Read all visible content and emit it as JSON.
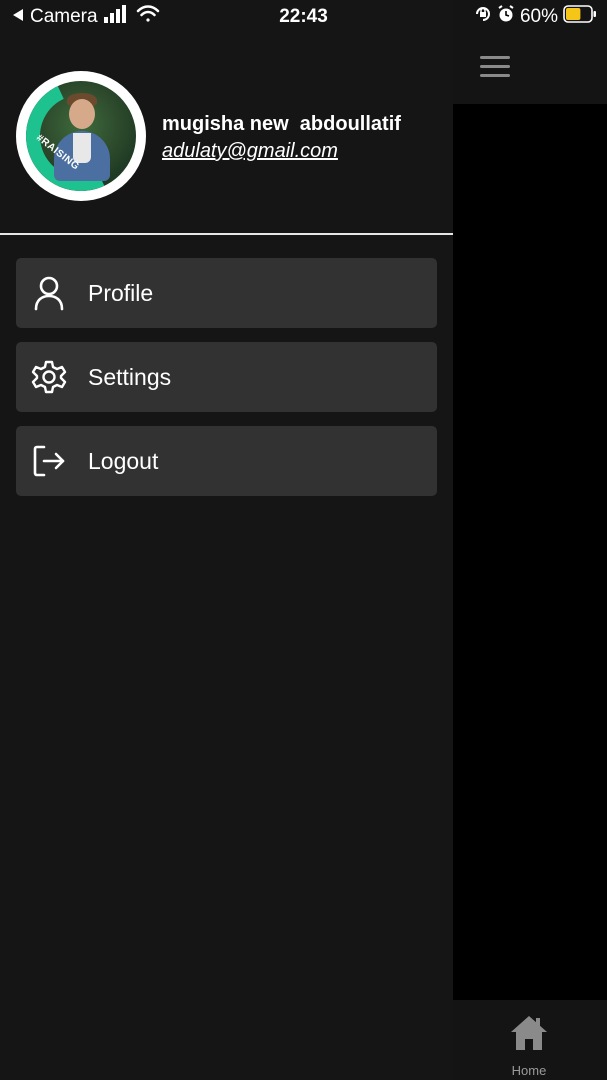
{
  "status_bar": {
    "back_label": "Camera",
    "time": "22:43",
    "battery_percent": "60%",
    "battery_level": 0.6,
    "icons": [
      "back-arrow-icon",
      "signal-icon",
      "wifi-icon",
      "orientation-lock-icon",
      "alarm-icon",
      "battery-icon"
    ]
  },
  "drawer": {
    "user": {
      "name": "mugisha new  abdoullatif",
      "email": "adulaty@gmail.com",
      "avatar_badge_text": "#RAISING"
    },
    "menu": [
      {
        "label": "Profile",
        "icon": "user-icon"
      },
      {
        "label": "Settings",
        "icon": "gear-icon"
      },
      {
        "label": "Logout",
        "icon": "logout-icon"
      }
    ]
  },
  "app": {
    "menu_icon": "hamburger-menu-icon",
    "bottom_nav": [
      {
        "label": "Home",
        "icon": "home-icon"
      }
    ]
  },
  "colors": {
    "drawer_bg": "#151515",
    "menu_item_bg": "#323232",
    "accent": "#1ec28f",
    "battery": "#f5c518"
  }
}
